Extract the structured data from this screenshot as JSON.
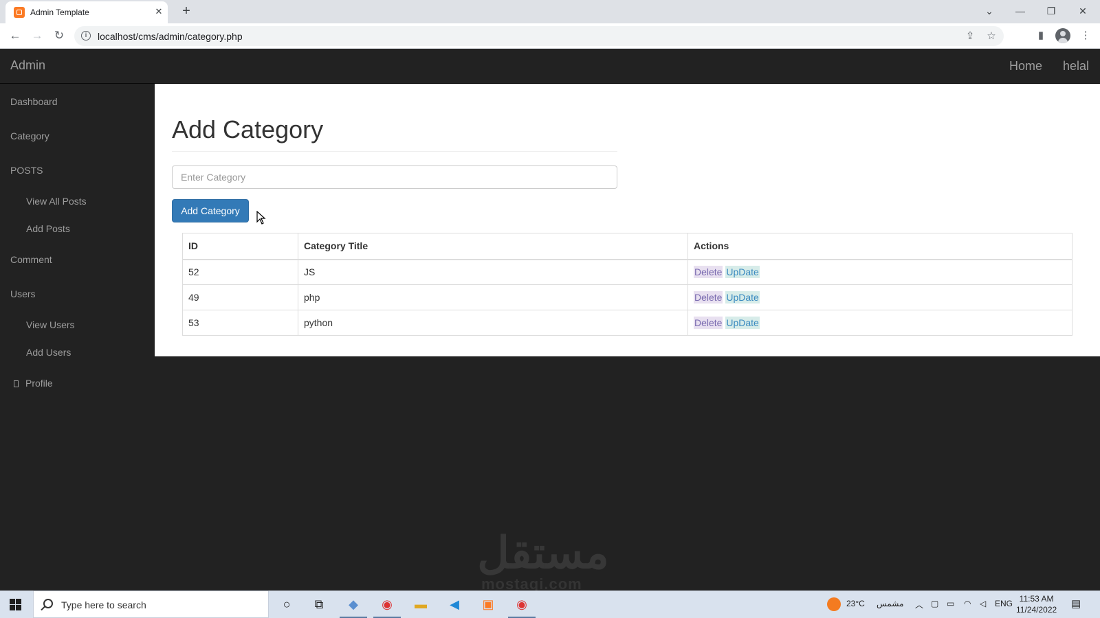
{
  "browser": {
    "tab_title": "Admin Template",
    "tab_close": "✕",
    "new_tab": "+",
    "url": "localhost/cms/admin/category.php",
    "window": {
      "collapse": "⌄",
      "minimize": "—",
      "restore": "❐",
      "close": "✕"
    }
  },
  "navbar": {
    "brand": "Admin",
    "links": {
      "home": "Home",
      "user": "helal"
    }
  },
  "sidebar": {
    "dashboard": "Dashboard",
    "category": "Category",
    "posts": "POSTS",
    "view_all_posts": "View All Posts",
    "add_posts": "Add Posts",
    "comment": "Comment",
    "users": "Users",
    "view_users": "View Users",
    "add_users": "Add Users",
    "profile": "Profile"
  },
  "main": {
    "title": "Add Category",
    "input_placeholder": "Enter Category",
    "input_value": "",
    "submit_label": "Add Category",
    "table": {
      "headers": [
        "ID",
        "Category Title",
        "Actions"
      ],
      "rows": [
        {
          "id": "52",
          "title": "JS",
          "delete": "Delete",
          "update": "UpDate"
        },
        {
          "id": "49",
          "title": "php",
          "delete": "Delete",
          "update": "UpDate"
        },
        {
          "id": "53",
          "title": "python",
          "delete": "Delete",
          "update": "UpDate"
        }
      ]
    }
  },
  "watermark": {
    "arabic": "مستقل",
    "latin": "mostaqi.com"
  },
  "taskbar": {
    "search_placeholder": "Type here to search",
    "weather": "23°C",
    "weather_desc": "مشمس",
    "language": "ENG",
    "time": "11:53 AM",
    "date": "11/24/2022"
  },
  "colors": {
    "primary_button": "#337ab7",
    "navbar_bg": "#222222",
    "nav_text": "#9d9d9d"
  }
}
